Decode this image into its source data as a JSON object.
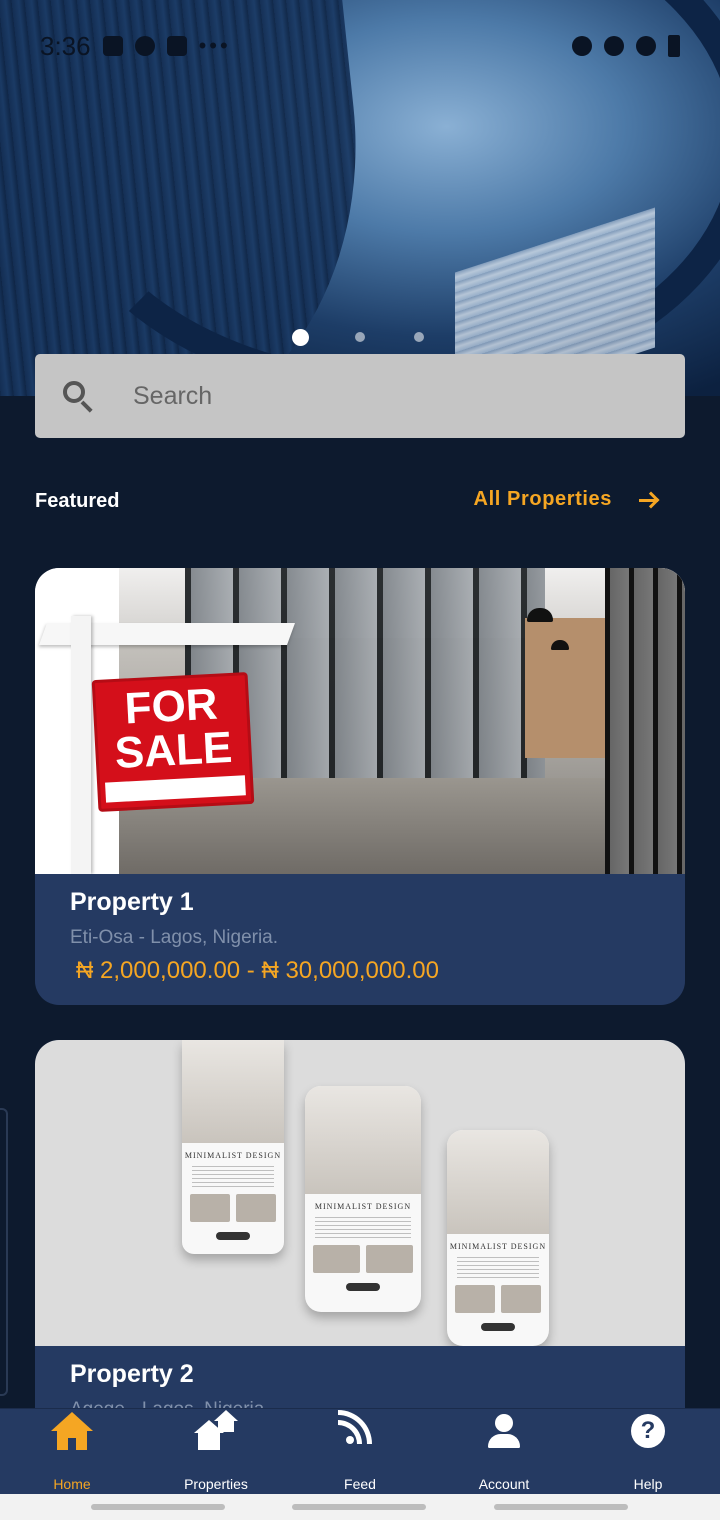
{
  "status_bar": {
    "time": "3:36"
  },
  "carousel": {
    "slide_count": 3,
    "active_index": 0
  },
  "search": {
    "placeholder": "Search"
  },
  "section": {
    "title": "Featured",
    "link_label": "All Properties"
  },
  "properties": [
    {
      "title": "Property 1",
      "location": "Eti-Osa - Lagos, Nigeria.",
      "price": "₦ 2,000,000.00 - ₦ 30,000,000.00",
      "image": {
        "sign_line1": "FOR",
        "sign_line2": "SALE"
      }
    },
    {
      "title": "Property 2",
      "location": "Agege - Lagos, Nigeria.",
      "image": {
        "mockup_heading": "MINIMALIST DESIGN"
      }
    }
  ],
  "bottom_nav": [
    {
      "label": "Home",
      "icon": "home-icon",
      "active": true
    },
    {
      "label": "Properties",
      "icon": "properties-icon",
      "active": false
    },
    {
      "label": "Feed",
      "icon": "rss-feed-icon",
      "active": false
    },
    {
      "label": "Account",
      "icon": "person-icon",
      "active": false
    },
    {
      "label": "Help",
      "icon": "help-icon",
      "active": false
    }
  ],
  "colors": {
    "background": "#0d1a2e",
    "card": "#253a62",
    "accent": "#f5a623",
    "search_bg": "#c5c5c5"
  }
}
